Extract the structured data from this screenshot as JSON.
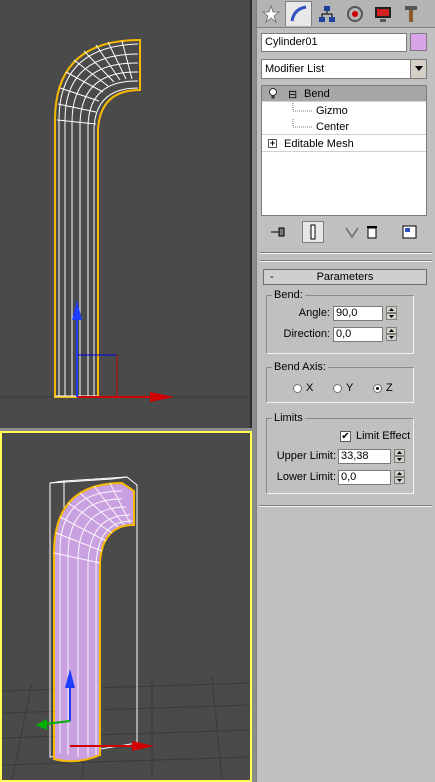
{
  "panel": {
    "object_name": "Cylinder01",
    "object_color": "#d9a5e8",
    "modifier_list": "Modifier List",
    "stack": [
      {
        "label": "Bend",
        "expander": "⊟"
      },
      {
        "label": "Gizmo"
      },
      {
        "label": "Center"
      },
      {
        "label": "Editable Mesh",
        "expander": "+"
      }
    ],
    "tabs": [
      "create-icon",
      "modify-icon",
      "hierarchy-icon",
      "motion-icon",
      "display-icon",
      "utilities-icon"
    ],
    "rollout_title": "Parameters",
    "rollout_toggle": "-",
    "bend": {
      "group_title": "Bend:",
      "angle_label": "Angle:",
      "angle_value": "90,0",
      "direction_label": "Direction:",
      "direction_value": "0,0"
    },
    "bend_axis": {
      "group_title": "Bend Axis:",
      "options": [
        "X",
        "Y",
        "Z"
      ],
      "selected": "Z"
    },
    "limits": {
      "group_title": "Limits",
      "limit_effect_label": "Limit Effect",
      "limit_effect_checked": true,
      "check_mark": "✔",
      "upper_label": "Upper Limit:",
      "upper_value": "33,38",
      "lower_label": "Lower Limit:",
      "lower_value": "0,0"
    }
  },
  "colors": {
    "viewport_bg": "#4a4a4a",
    "wire_selected": "#ffffff",
    "bbox": "#f5b800",
    "active_viewport": "#ffff55",
    "object_purple": "#c9a0e0",
    "axis_x": "#d00000",
    "axis_y": "#00a000",
    "axis_z": "#0000e0"
  }
}
